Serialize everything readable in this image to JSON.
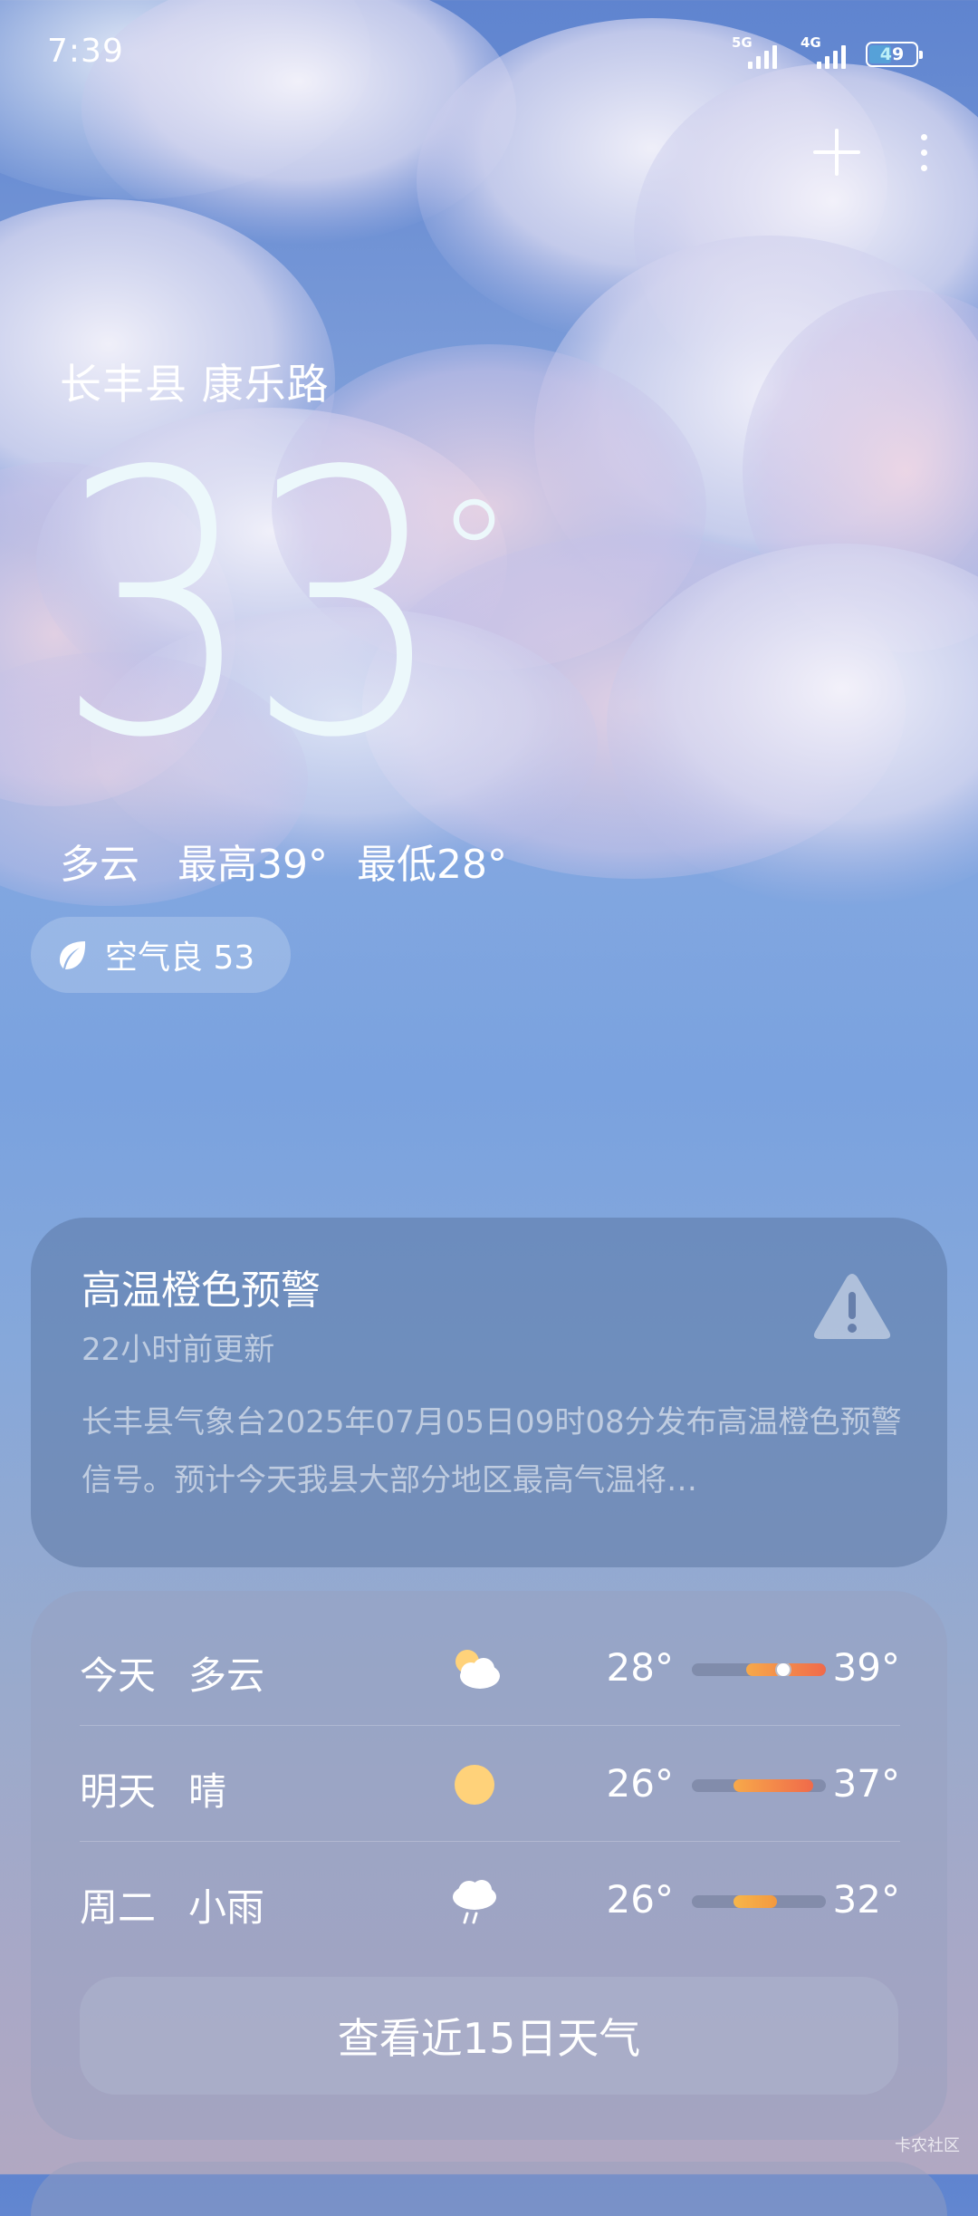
{
  "status_bar": {
    "time": "7:39",
    "network_1": "5G",
    "network_2": "4G",
    "battery": "49"
  },
  "header": {
    "location": "长丰县 康乐路"
  },
  "current": {
    "temperature": "33",
    "unit": "°",
    "condition": "多云",
    "high": "最高39°",
    "low": "最低28°",
    "aqi_label": "空气良 53"
  },
  "warning": {
    "title": "高温橙色预警",
    "updated": "22小时前更新",
    "body": "长丰县气象台2025年07月05日09时08分发布高温橙色预警信号。预计今天我县大部分地区最高气温将…"
  },
  "forecast": {
    "rows": [
      {
        "day": "今天",
        "condition": "多云",
        "icon": "partly-cloudy-icon",
        "low": "28°",
        "high": "39°"
      },
      {
        "day": "明天",
        "condition": "晴",
        "icon": "sun-icon",
        "low": "26°",
        "high": "37°"
      },
      {
        "day": "周二",
        "condition": "小雨",
        "icon": "light-rain-icon",
        "low": "26°",
        "high": "32°"
      }
    ],
    "more_button": "查看近15日天气"
  },
  "watermark": "卡农社区",
  "colors": {
    "warm_bar_start": "#f7a94a",
    "warm_bar_end": "#f06a4a",
    "sun": "#ffd27a"
  }
}
